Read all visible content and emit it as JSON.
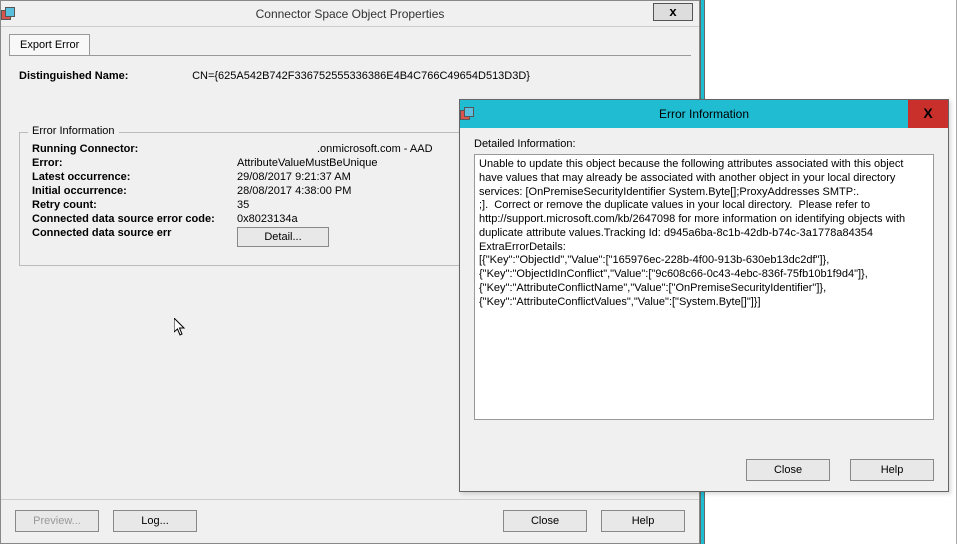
{
  "main": {
    "title": "Connector Space Object Properties",
    "tab": "Export Error",
    "dn_label": "Distinguished Name:",
    "dn_value": "CN={625A542B742F336752555336386E4B4C766C49654D513D3D}",
    "fieldset_title": "Error Information",
    "rows": {
      "running_connector": {
        "label": "Running Connector:",
        "value": ".onmicrosoft.com - AAD"
      },
      "error": {
        "label": "Error:",
        "value": "AttributeValueMustBeUnique"
      },
      "latest": {
        "label": "Latest occurrence:",
        "value": "29/08/2017 9:21:37 AM"
      },
      "initial": {
        "label": "Initial occurrence:",
        "value": "28/08/2017 4:38:00 PM"
      },
      "retry": {
        "label": "Retry count:",
        "value": "35"
      },
      "errcode": {
        "label": "Connected data source error code:",
        "value": "0x8023134a"
      },
      "errmsg": {
        "label": "Connected data source err",
        "value": ""
      }
    },
    "detail_btn": "Detail...",
    "preview_btn": "Preview...",
    "log_btn": "Log...",
    "close_btn": "Close",
    "help_btn": "Help"
  },
  "error_dialog": {
    "title": "Error Information",
    "detail_label": "Detailed Information:",
    "detail_text": "Unable to update this object because the following attributes associated with this object have values that may already be associated with another object in your local directory services: [OnPremiseSecurityIdentifier System.Byte[];ProxyAddresses SMTP:.                                             ;].  Correct or remove the duplicate values in your local directory.  Please refer to http://support.microsoft.com/kb/2647098 for more information on identifying objects with duplicate attribute values.Tracking Id: d945a6ba-8c1b-42db-b74c-3a1778a84354\nExtraErrorDetails:\n[{\"Key\":\"ObjectId\",\"Value\":[\"165976ec-228b-4f00-913b-630eb13dc2df\"]},{\"Key\":\"ObjectIdInConflict\",\"Value\":[\"9c608c66-0c43-4ebc-836f-75fb10b1f9d4\"]},{\"Key\":\"AttributeConflictName\",\"Value\":[\"OnPremiseSecurityIdentifier\"]},{\"Key\":\"AttributeConflictValues\",\"Value\":[\"System.Byte[]\"]}]",
    "close_btn": "Close",
    "help_btn": "Help"
  }
}
